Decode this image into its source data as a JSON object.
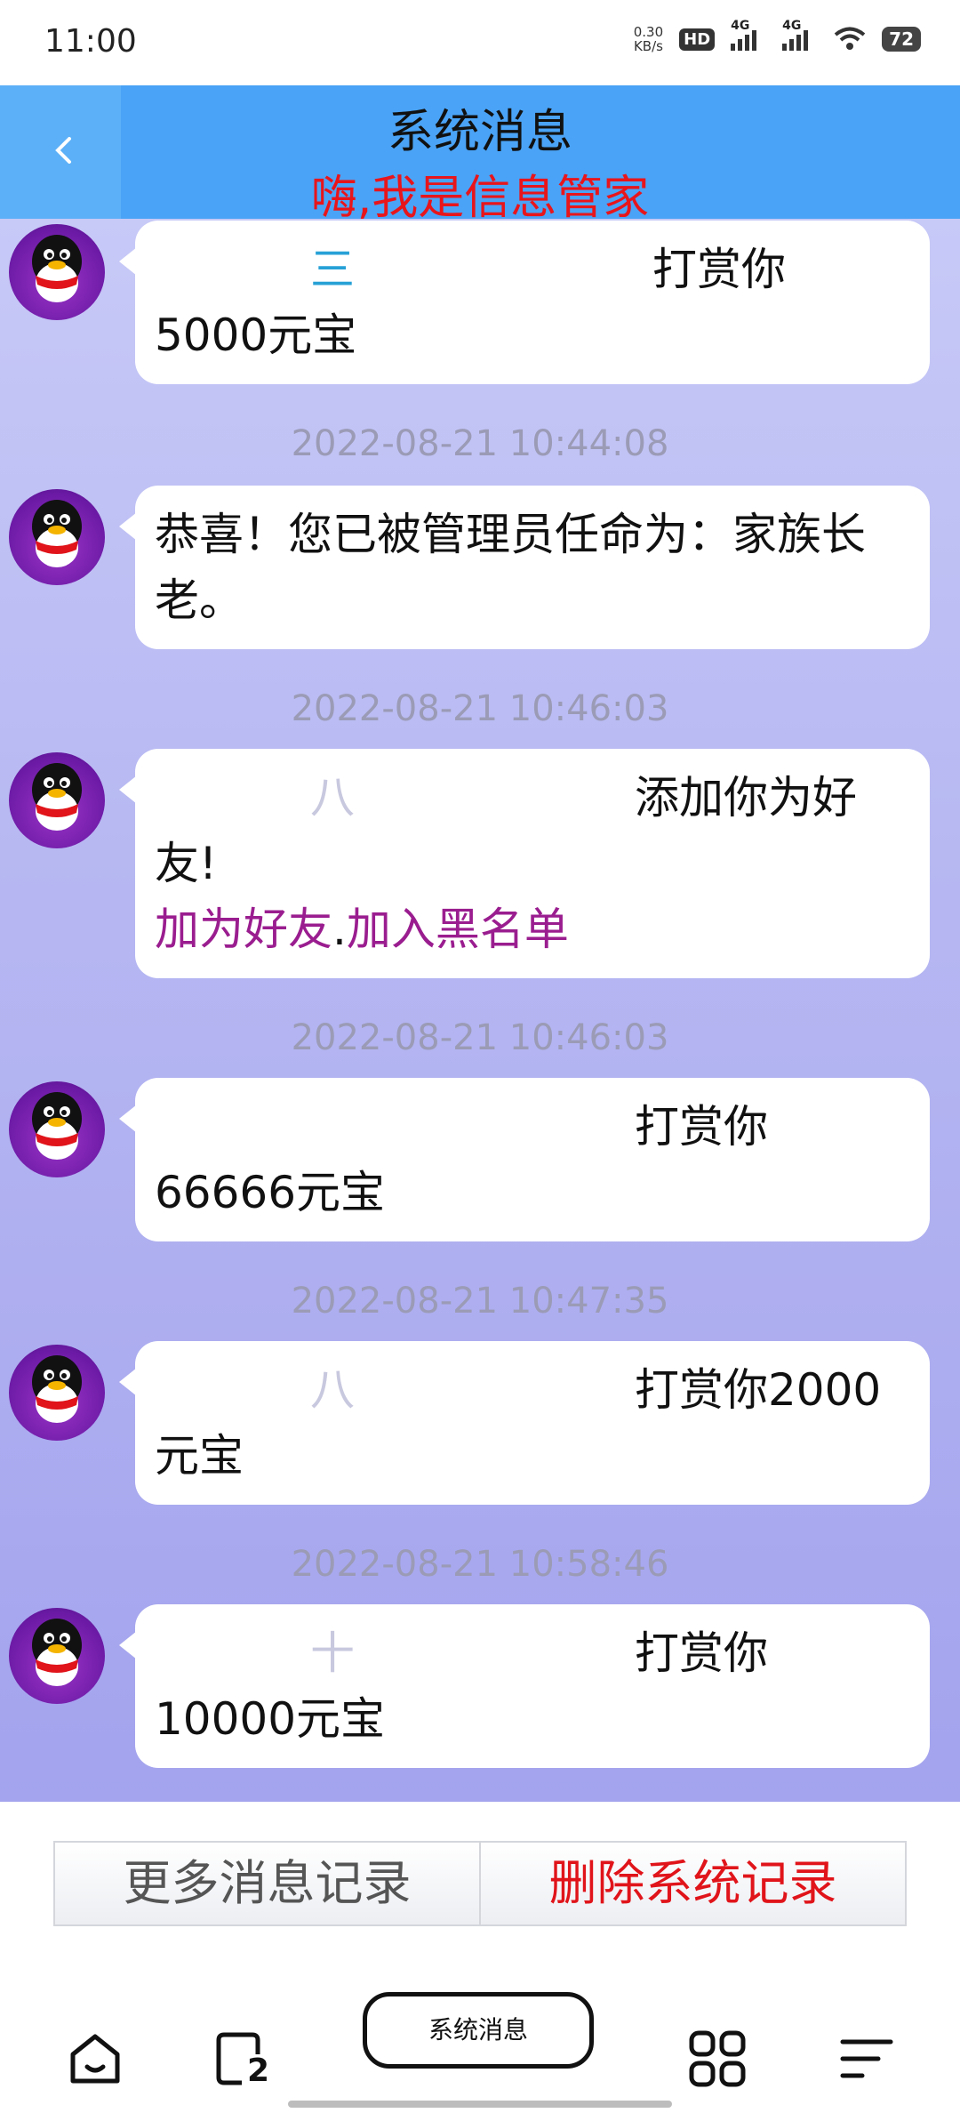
{
  "status": {
    "time": "11:00",
    "speed_value": "0.30",
    "speed_unit": "KB/s",
    "hd": "HD",
    "network1": "4G",
    "network2": "4G",
    "battery": "72"
  },
  "header": {
    "title": "系统消息",
    "subtitle": "嗨,我是信息管家"
  },
  "messages": [
    {
      "sender": "三",
      "action": "打赏你",
      "text": "5000元宝",
      "timestamp": ""
    },
    {
      "timestamp": "2022-08-21 10:44:08",
      "text": "恭喜！您已被管理员任命为：家族长老。"
    },
    {
      "timestamp": "2022-08-21 10:46:03",
      "sender": "八",
      "action": "添加你为好",
      "text": "友!",
      "link_add": "加为好友",
      "link_sep": ".",
      "link_block": "加入黑名单"
    },
    {
      "timestamp": "2022-08-21 10:46:03",
      "sender": "",
      "action": "打赏你",
      "text": "66666元宝"
    },
    {
      "timestamp": "2022-08-21 10:47:35",
      "sender": "八",
      "action": "打赏你2000",
      "text": "元宝"
    },
    {
      "timestamp": "2022-08-21 10:58:46",
      "sender": "十",
      "action": "打赏你",
      "text": "10000元宝"
    }
  ],
  "actions": {
    "more": "更多消息记录",
    "delete": "删除系统记录"
  },
  "nav": {
    "center_label": "系统消息",
    "recent_count": "2"
  }
}
